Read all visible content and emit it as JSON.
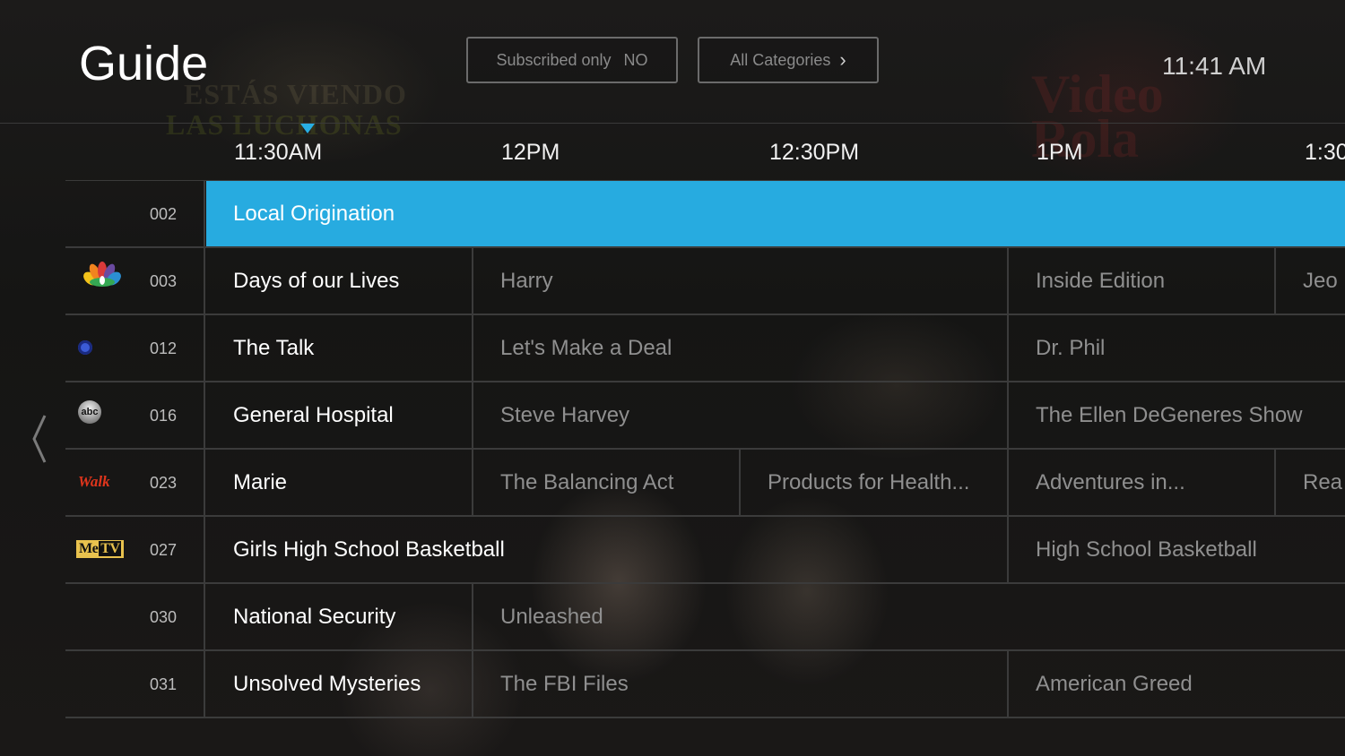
{
  "header": {
    "title": "Guide",
    "subscribed_label": "Subscribed only",
    "subscribed_value": "NO",
    "categories_label": "All Categories",
    "clock": "11:41 AM"
  },
  "timeline": [
    "11:30AM",
    "12PM",
    "12:30PM",
    "1PM",
    "1:30"
  ],
  "channels": [
    {
      "number": "002",
      "logo": "",
      "programs": [
        {
          "title": "Local Origination"
        }
      ]
    },
    {
      "number": "003",
      "logo": "nbc-peacock-icon",
      "programs": [
        {
          "title": "Days of our Lives"
        },
        {
          "title": "Harry"
        },
        {
          "title": "Inside Edition"
        },
        {
          "title": "Jeo"
        }
      ]
    },
    {
      "number": "012",
      "logo": "cbs-eye-icon",
      "programs": [
        {
          "title": "The Talk"
        },
        {
          "title": "Let's Make a Deal"
        },
        {
          "title": "Dr. Phil"
        }
      ]
    },
    {
      "number": "016",
      "logo": "abc-logo",
      "programs": [
        {
          "title": "General Hospital"
        },
        {
          "title": "Steve Harvey"
        },
        {
          "title": "The Ellen DeGeneres Show"
        }
      ]
    },
    {
      "number": "023",
      "logo": "walk-logo",
      "programs": [
        {
          "title": "Marie"
        },
        {
          "title": "The Balancing Act"
        },
        {
          "title": "Products for Health..."
        },
        {
          "title": "Adventures in..."
        },
        {
          "title": "Rea"
        }
      ]
    },
    {
      "number": "027",
      "logo": "metv-logo",
      "programs": [
        {
          "title": "Girls High School Basketball"
        },
        {
          "title": "High School Basketball"
        }
      ]
    },
    {
      "number": "030",
      "logo": "",
      "programs": [
        {
          "title": "National Security"
        },
        {
          "title": "Unleashed"
        }
      ]
    },
    {
      "number": "031",
      "logo": "",
      "programs": [
        {
          "title": "Unsolved Mysteries"
        },
        {
          "title": "The FBI Files"
        },
        {
          "title": "American Greed"
        }
      ]
    }
  ],
  "logo_text": {
    "abc": "abc",
    "walk": "Walk",
    "metv_me": "Me",
    "metv_tv": "TV"
  },
  "colors": {
    "accent": "#27abe0",
    "background": "#151515",
    "grid_line": "#3b3b3b"
  }
}
